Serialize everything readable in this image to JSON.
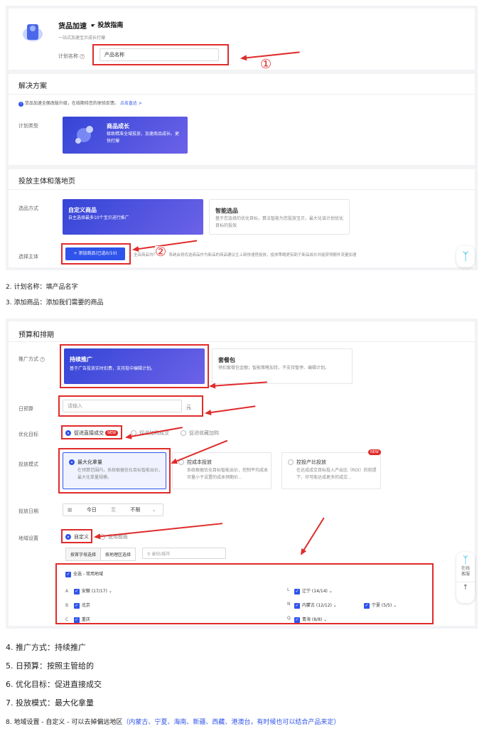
{
  "screenshot1": {
    "header": {
      "title": "货品加速",
      "guide": "投放指南",
      "subtitle": "一站式加速宝贝成长打爆",
      "plan_name_label": "计划名称",
      "plan_name_placeholder": "产品名称",
      "annotation": "①"
    },
    "solution": {
      "title": "解决方案",
      "notice": "货品加速全面改版升级，在线期待您的体验反馈。",
      "notice_link": "点击直达 >",
      "plan_type_label": "计划类型",
      "card_title": "商品成长",
      "card_desc": "极致精准全域投放，加速商品成长、更快打爆"
    },
    "subject": {
      "title": "投放主体和落地页",
      "method_label": "选品方式",
      "custom_title": "自定义商品",
      "custom_desc": "自主选择最多10个宝贝进行推广",
      "smart_title": "智能选品",
      "smart_desc": "基于您选择的优化目标，算法智能为您投放宝贝，最大化该计划优化目标的投效",
      "select_label": "选择主体",
      "add_button": "+ 添加商品(已选0/10)",
      "select_hint": "全店商品均可投放，系统会将优选商品作为新品的商品建议主上新快速搭投放，投放策略更有助于新品成长并能获得额外流量加速",
      "annotation": "②"
    }
  },
  "notes_a": [
    "2.  计划名称：填产品名字",
    "3.  添加商品：添加我们需要的商品"
  ],
  "screenshot2": {
    "title": "预算和排期",
    "promo_label": "推广方式",
    "promo_sustain_title": "持续推广",
    "promo_sustain_desc": "基于广告投放实时扣费，支持投中编辑计划。",
    "promo_package_title": "套餐包",
    "promo_package_desc": "预扣套餐包金额；智能策略加持，不支持暂停、编辑计划。",
    "budget_label": "日预算",
    "budget_placeholder": "请输入",
    "budget_unit": "元",
    "goal_label": "优化目标",
    "goal_options": [
      "促进直接成交",
      "促进加购成交",
      "促进收藏加购"
    ],
    "goal_new": "NEW",
    "mode_label": "投放模式",
    "mode_cards": [
      {
        "title": "最大化拿量",
        "desc": "在预算范围内，系统根据优化目标智能出价，最大化拿量规模。"
      },
      {
        "title": "控成本投放",
        "desc": "系统根据优化目标智能出价，控制平均成本尽量小于设置的成本预期价..."
      },
      {
        "title": "控投产比投放",
        "desc": "在达成成交目标投入产出比（ROI）的前提下，尽可能达成更多的成交..."
      }
    ],
    "mode_new": "NEW",
    "date_label": "投放日期",
    "date_start": "今日",
    "date_sep": "至",
    "date_end": "不限",
    "region_label": "地域设置",
    "region_options": [
      "自定义",
      "使用模板"
    ],
    "region_tabs": [
      "按首字母选择",
      "按地理区选择"
    ],
    "region_search_placeholder": "省份/城市",
    "region_all": "全选 - 常用地域",
    "region_rows": [
      {
        "letter": "A",
        "name": "安徽 (17/17)",
        "letter2": "L",
        "name2": "辽宁 (14/14)",
        "name3": ""
      },
      {
        "letter": "B",
        "name": "北京",
        "letter2": "N",
        "name2": "内蒙古 (12/12)",
        "name3": "宁夏 (5/5)"
      },
      {
        "letter": "C",
        "name": "重庆",
        "letter2": "Q",
        "name2": "青海 (8/8)",
        "name3": ""
      }
    ],
    "widget_online": "在线客服",
    "widget_top": "↑"
  },
  "notes_b": [
    "4.  推广方式：持续推广",
    "5.  日预算：按照主管给的",
    "6.  优化目标：促进直接成交",
    "7.  投放模式：最大化拿量"
  ],
  "note_8_main": "8.  地域设置 - 自定义 - 可以去掉偏远地区",
  "note_8_highlight": "（内蒙古、宁夏、海南、新疆、西藏、港澳台，有时候也可以结合产品来定）"
}
